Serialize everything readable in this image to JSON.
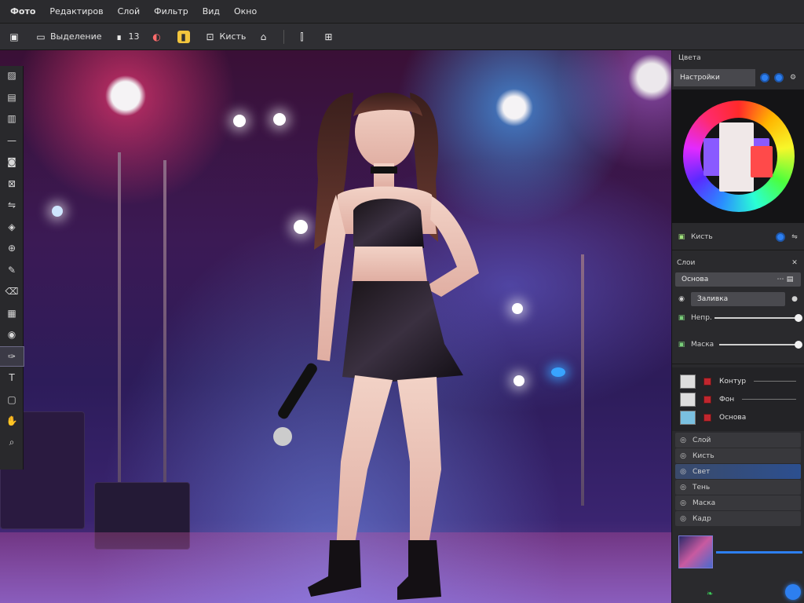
{
  "menubar": {
    "items": [
      "Фото",
      "Редактиров",
      "Слой",
      "Фильтр",
      "Вид",
      "Окно"
    ]
  },
  "options": {
    "items": [
      {
        "icon": "image-icon",
        "glyph": "▣",
        "label": ""
      },
      {
        "icon": "frame-icon",
        "glyph": "▭",
        "label": "Выделение"
      },
      {
        "icon": "size-icon",
        "glyph": "∎",
        "label": "13"
      },
      {
        "icon": "color-icon",
        "glyph": "◐",
        "label": ""
      },
      {
        "icon": "palette-icon",
        "glyph": "▮",
        "label": ""
      },
      {
        "icon": "brush-icon",
        "glyph": "⊡",
        "label": "Кисть"
      },
      {
        "icon": "path-icon",
        "glyph": "⌂",
        "label": ""
      },
      {
        "icon": "transform-icon",
        "glyph": "⫿",
        "label": ""
      },
      {
        "icon": "crop-icon",
        "glyph": "⊞",
        "label": ""
      }
    ]
  },
  "toolbox": {
    "tools": [
      {
        "name": "photo-tool-icon",
        "glyph": "▨"
      },
      {
        "name": "image-tool-icon",
        "glyph": "▤"
      },
      {
        "name": "adjust-tool-icon",
        "glyph": "▥"
      },
      {
        "name": "line-tool-icon",
        "glyph": "—"
      },
      {
        "name": "lasso-tool-icon",
        "glyph": "◙"
      },
      {
        "name": "crop-tool-icon",
        "glyph": "⊠"
      },
      {
        "name": "move-tool-icon",
        "glyph": "⇋"
      },
      {
        "name": "heal-tool-icon",
        "glyph": "◈"
      },
      {
        "name": "stamp-tool-icon",
        "glyph": "⊕"
      },
      {
        "name": "brush-tool-icon",
        "glyph": "✎"
      },
      {
        "name": "eraser-tool-icon",
        "glyph": "⌫"
      },
      {
        "name": "gradient-tool-icon",
        "glyph": "▦"
      },
      {
        "name": "blur-tool-icon",
        "glyph": "◉"
      },
      {
        "name": "pen-tool-icon",
        "glyph": "✑"
      },
      {
        "name": "text-tool-icon",
        "glyph": "T"
      },
      {
        "name": "shape-tool-icon",
        "glyph": "▢"
      },
      {
        "name": "hand-tool-icon",
        "glyph": "✋"
      },
      {
        "name": "zoom-tool-icon",
        "glyph": "⌕"
      }
    ],
    "active_index": 13
  },
  "panel": {
    "header": "Цвета",
    "tab_label": "Настройки",
    "color": {
      "swatches": [
        "#ff4a4a",
        "#f0f0f0",
        "#8a5aff"
      ]
    },
    "tool_row": {
      "label": "Кисть"
    },
    "section_title": "Слои",
    "layer_header": "Основа",
    "opacity_label": "Заливка",
    "slider1_label": "Непр.",
    "slider2_label": "Маска",
    "layers": [
      {
        "label": "Контур"
      },
      {
        "label": "Фон"
      },
      {
        "label": "Основа"
      }
    ],
    "history": [
      {
        "label": "Слой",
        "selected": false
      },
      {
        "label": "Кисть",
        "selected": false
      },
      {
        "label": "Свет",
        "selected": true
      },
      {
        "label": "Тень",
        "selected": false
      },
      {
        "label": "Маска",
        "selected": false
      },
      {
        "label": "Кадр",
        "selected": false
      }
    ]
  },
  "accent": "#2d7ff0"
}
